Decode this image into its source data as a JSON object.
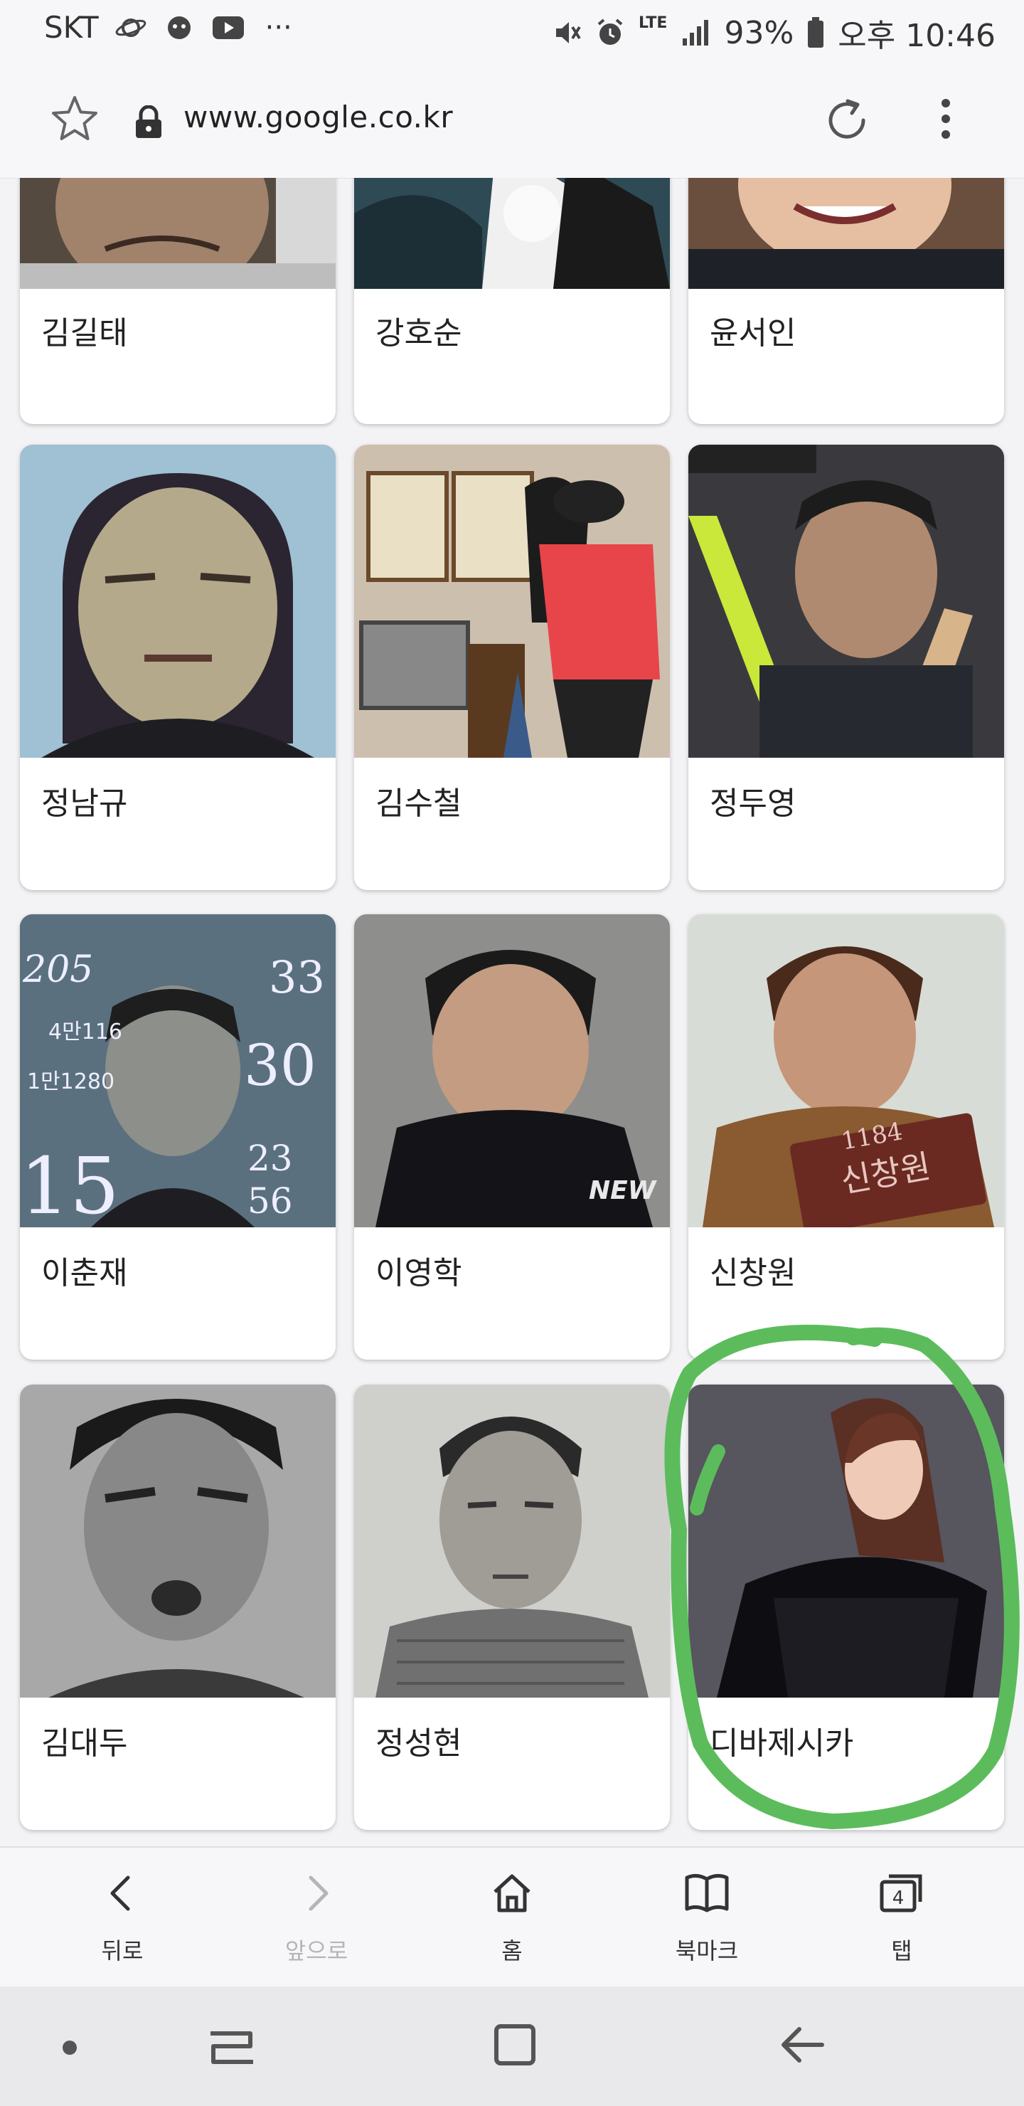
{
  "status_bar": {
    "carrier": "SKT",
    "battery": "93%",
    "time": "오후 10:46",
    "network": "LTE",
    "more": "···"
  },
  "browser": {
    "url": "www.google.co.kr"
  },
  "results": [
    {
      "name": "김길태"
    },
    {
      "name": "강호순"
    },
    {
      "name": "윤서인"
    },
    {
      "name": "정남규"
    },
    {
      "name": "김수철"
    },
    {
      "name": "정두영"
    },
    {
      "name": "이춘재"
    },
    {
      "name": "이영학"
    },
    {
      "name": "신창원"
    },
    {
      "name": "김대두"
    },
    {
      "name": "정성현"
    },
    {
      "name": "디바제시카"
    }
  ],
  "photo_text": {
    "poster_number_1": "205",
    "poster_number_2": "33",
    "poster_number_3": "4만116",
    "poster_number_4": "1만1280",
    "poster_number_5": "30",
    "poster_number_6": "15",
    "poster_number_7": "23",
    "poster_number_8": "56",
    "shirt_text": "NEW",
    "placard_text_1": "1184",
    "placard_text_2": "신창원"
  },
  "bottom_nav": {
    "back": "뒤로",
    "forward": "앞으로",
    "home": "홈",
    "bookmarks": "북마크",
    "tabs": "탭",
    "tab_count": "4"
  },
  "annotation": {
    "color": "#5cbc5c",
    "target": "디바제시카"
  }
}
